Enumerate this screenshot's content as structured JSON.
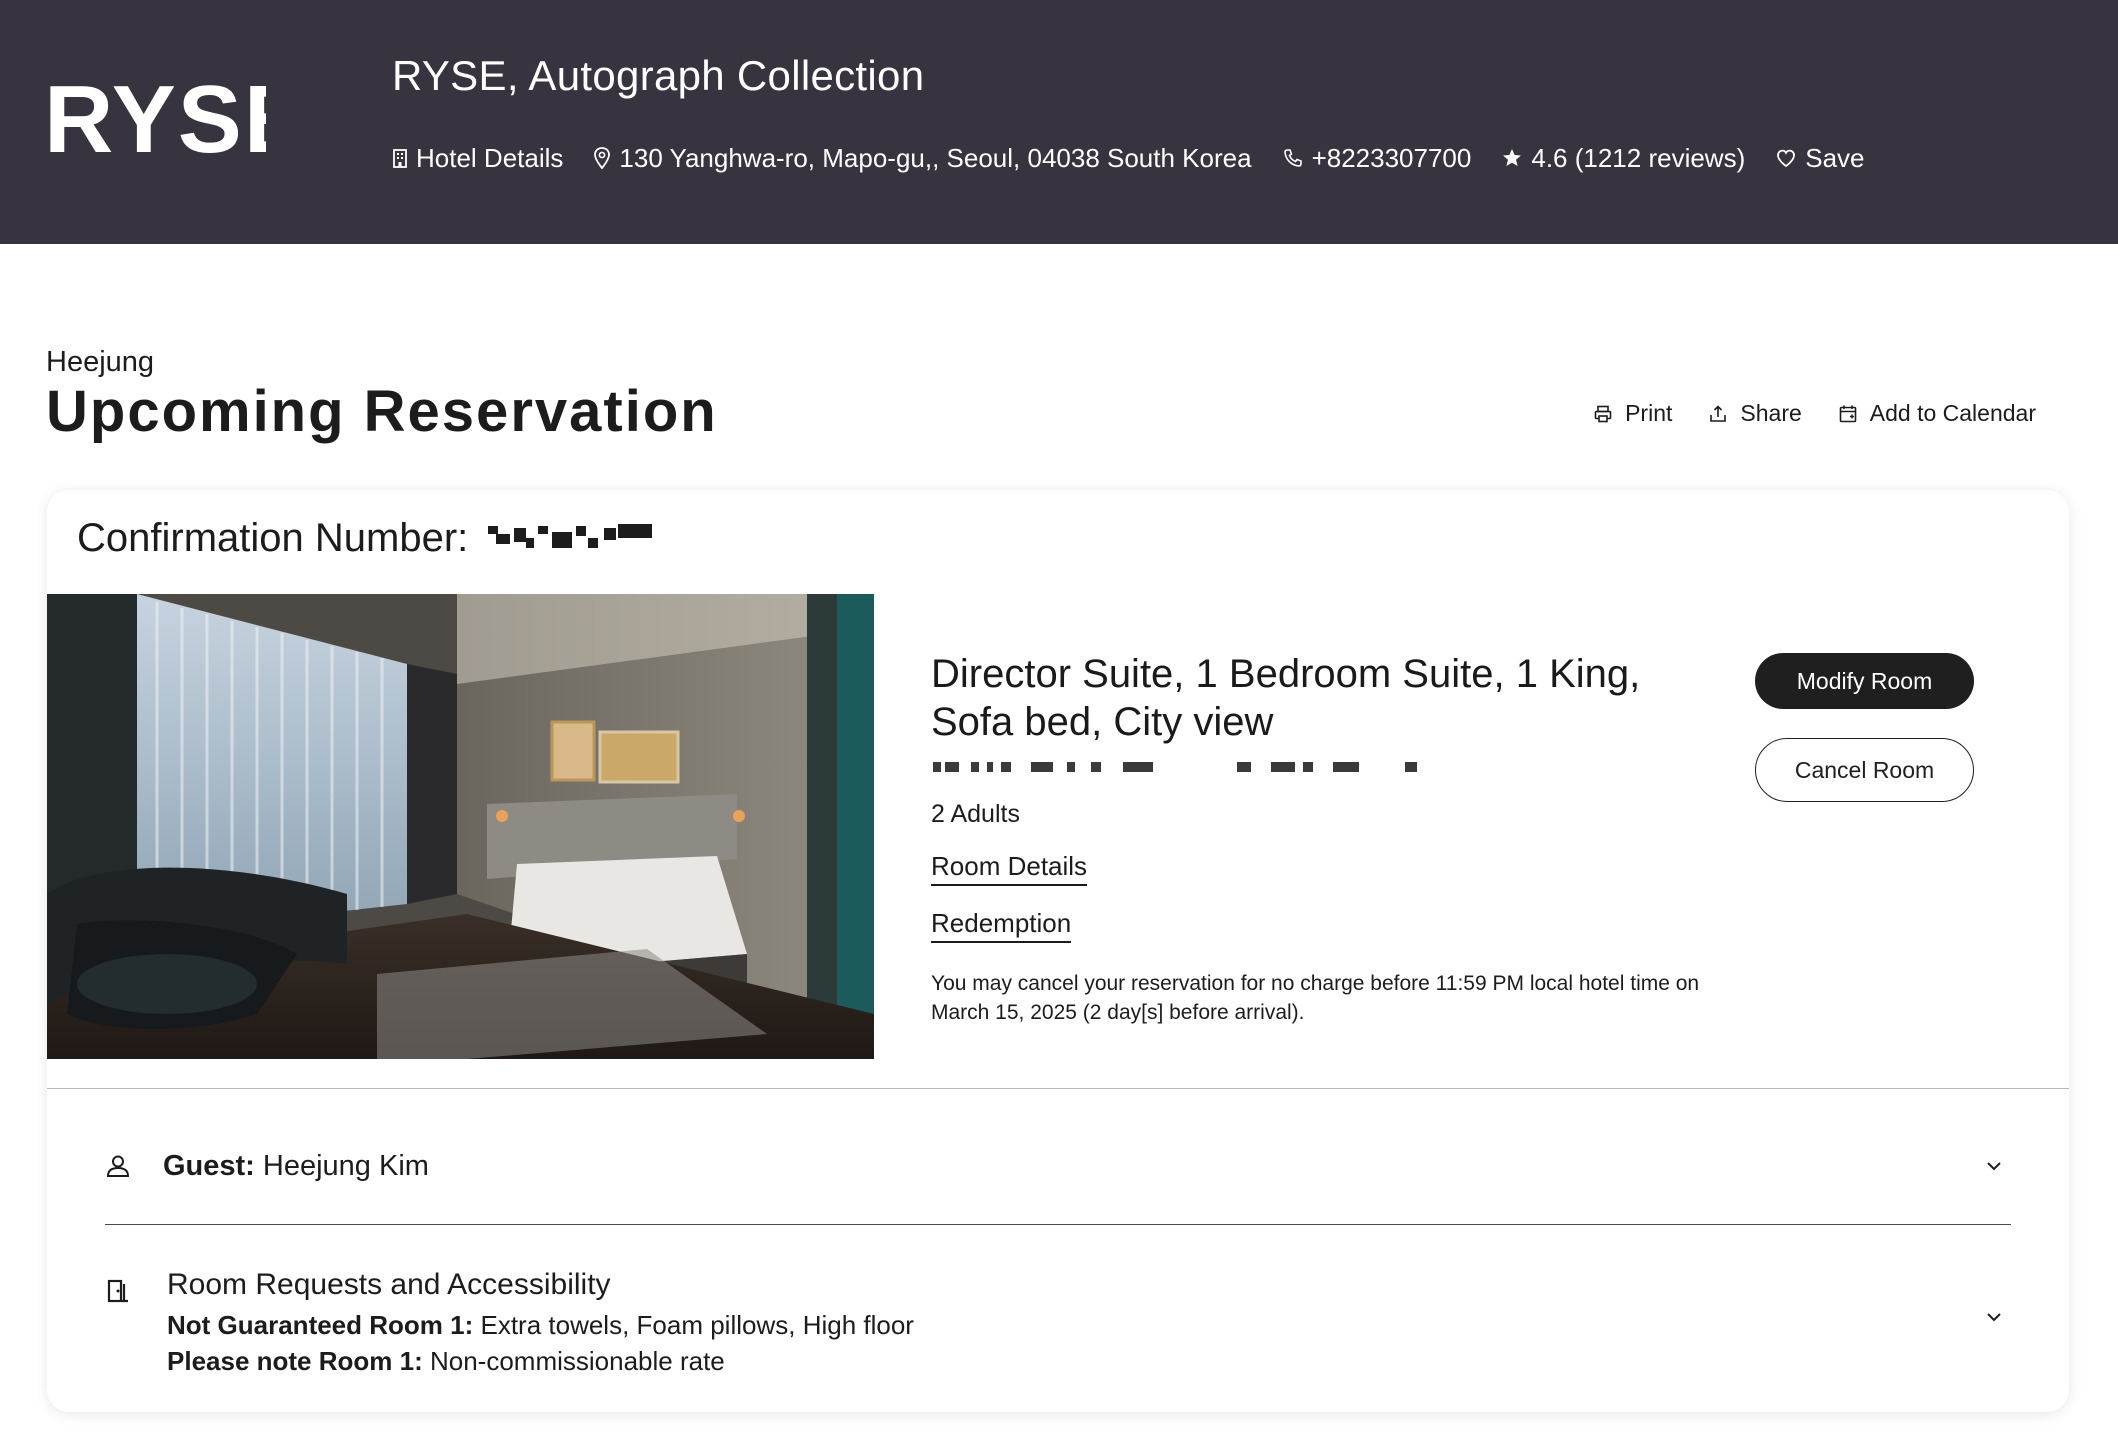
{
  "header": {
    "logo_text": "RYSE",
    "hotel_name": "RYSE, Autograph Collection",
    "hotel_details_label": "Hotel Details",
    "address": "130 Yanghwa-ro, Mapo-gu,, Seoul, 04038 South Korea",
    "phone": "+8223307700",
    "rating": "4.6 (1212 reviews)",
    "save_label": "Save"
  },
  "page": {
    "greeting_name": "Heejung",
    "title": "Upcoming Reservation",
    "actions": {
      "print": "Print",
      "share": "Share",
      "calendar": "Add to Calendar"
    }
  },
  "reservation": {
    "confirmation_label": "Confirmation Number:",
    "room_name": "Director Suite, 1 Bedroom Suite, 1 King, Sofa bed, City view",
    "guests": "2 Adults",
    "room_details_link": "Room Details",
    "redemption_link": "Redemption",
    "cancellation_note": "You may cancel your reservation for no charge before 11:59 PM local hotel time on March 15, 2025 (2 day[s] before arrival).",
    "modify_button": "Modify Room",
    "cancel_button": "Cancel Room"
  },
  "guest_section": {
    "label": "Guest:",
    "name": "Heejung Kim"
  },
  "requests_section": {
    "title": "Room Requests and Accessibility",
    "line1_label": "Not Guaranteed Room 1:",
    "line1_value": "Extra towels, Foam pillows, High floor",
    "line2_label": "Please note Room 1:",
    "line2_value": "Non-commissionable rate"
  },
  "colors": {
    "header_bg": "#37333f",
    "button_dark": "#1f1f1f",
    "text": "#1c1c1c"
  },
  "icons": [
    "building-icon",
    "map-pin-icon",
    "phone-icon",
    "star-icon",
    "heart-icon",
    "printer-icon",
    "share-icon",
    "calendar-icon",
    "user-icon",
    "door-icon",
    "chevron-down-icon"
  ]
}
